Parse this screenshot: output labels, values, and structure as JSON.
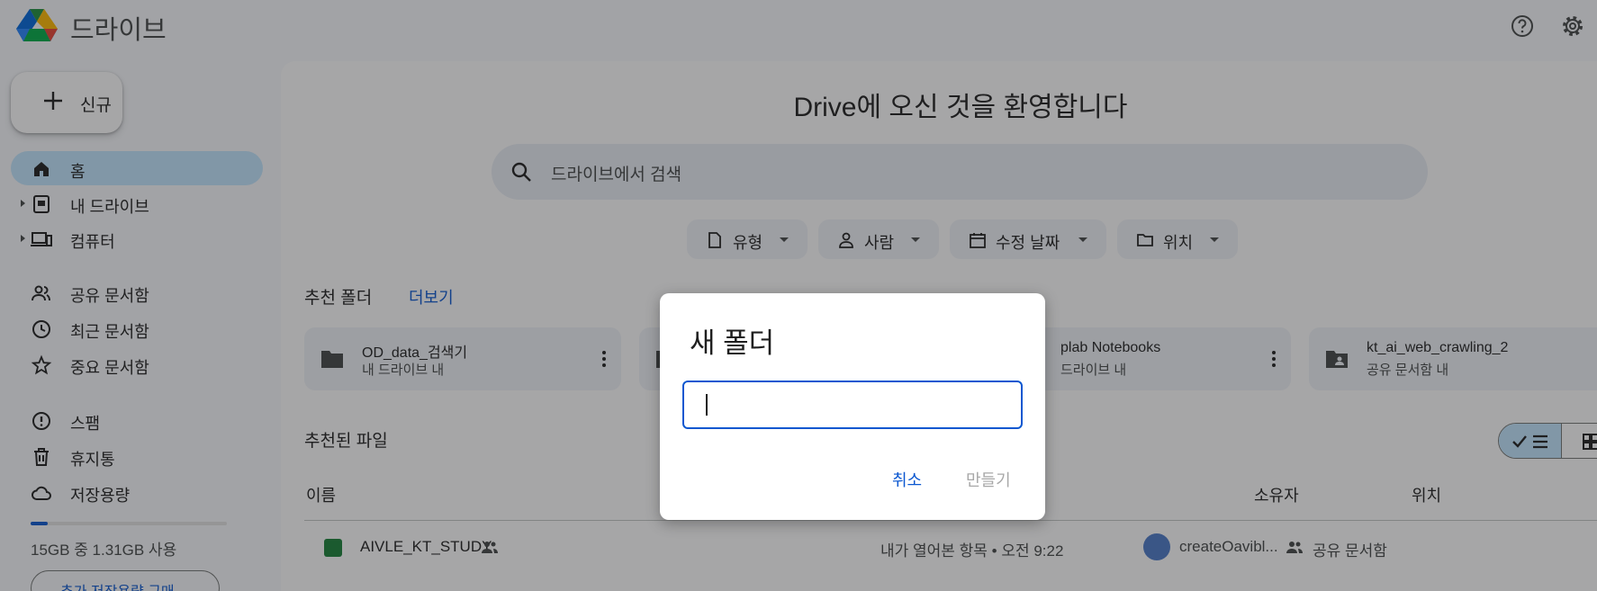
{
  "app": {
    "name": "드라이브"
  },
  "sidebar": {
    "new_label": "신규",
    "items": [
      {
        "label": "홈"
      },
      {
        "label": "내 드라이브"
      },
      {
        "label": "컴퓨터"
      },
      {
        "label": "공유 문서함"
      },
      {
        "label": "최근 문서함"
      },
      {
        "label": "중요 문서함"
      },
      {
        "label": "스팸"
      },
      {
        "label": "휴지통"
      },
      {
        "label": "저장용량"
      }
    ],
    "storage": {
      "used_fraction": 0.087,
      "text": "15GB 중 1.31GB 사용"
    },
    "buy_label": "추가 저장용량 구매"
  },
  "main": {
    "welcome": "Drive에 오신 것을 환영합니다",
    "search_placeholder": "드라이브에서 검색",
    "filters": [
      {
        "label": "유형"
      },
      {
        "label": "사람"
      },
      {
        "label": "수정 날짜"
      },
      {
        "label": "위치"
      }
    ],
    "suggested_folders_title": "추천 폴더",
    "more_label": "더보기",
    "folders": [
      {
        "name": "OD_data_검색기",
        "location": "내 드라이브 내"
      },
      {
        "name": "plab Notebooks",
        "location": "드라이브 내"
      },
      {
        "name": "kt_ai_web_crawling_2",
        "location": "공유 문서함 내"
      }
    ],
    "suggested_files_title": "추천된 파일",
    "columns": {
      "name": "이름",
      "owner": "소유자",
      "location": "위치"
    },
    "files": [
      {
        "name": "AIVLE_KT_STUDY",
        "reason": "내가 열어본 항목 • 오전 9:22",
        "owner": "createOavibl...",
        "location": "공유 문서함"
      }
    ]
  },
  "dialog": {
    "title": "새 폴더",
    "input_value": "",
    "cancel_label": "취소",
    "create_label": "만들기"
  },
  "colors": {
    "accent": "#0b57d0",
    "nav_active": "#c2e7ff",
    "sheets_green": "#188038"
  }
}
